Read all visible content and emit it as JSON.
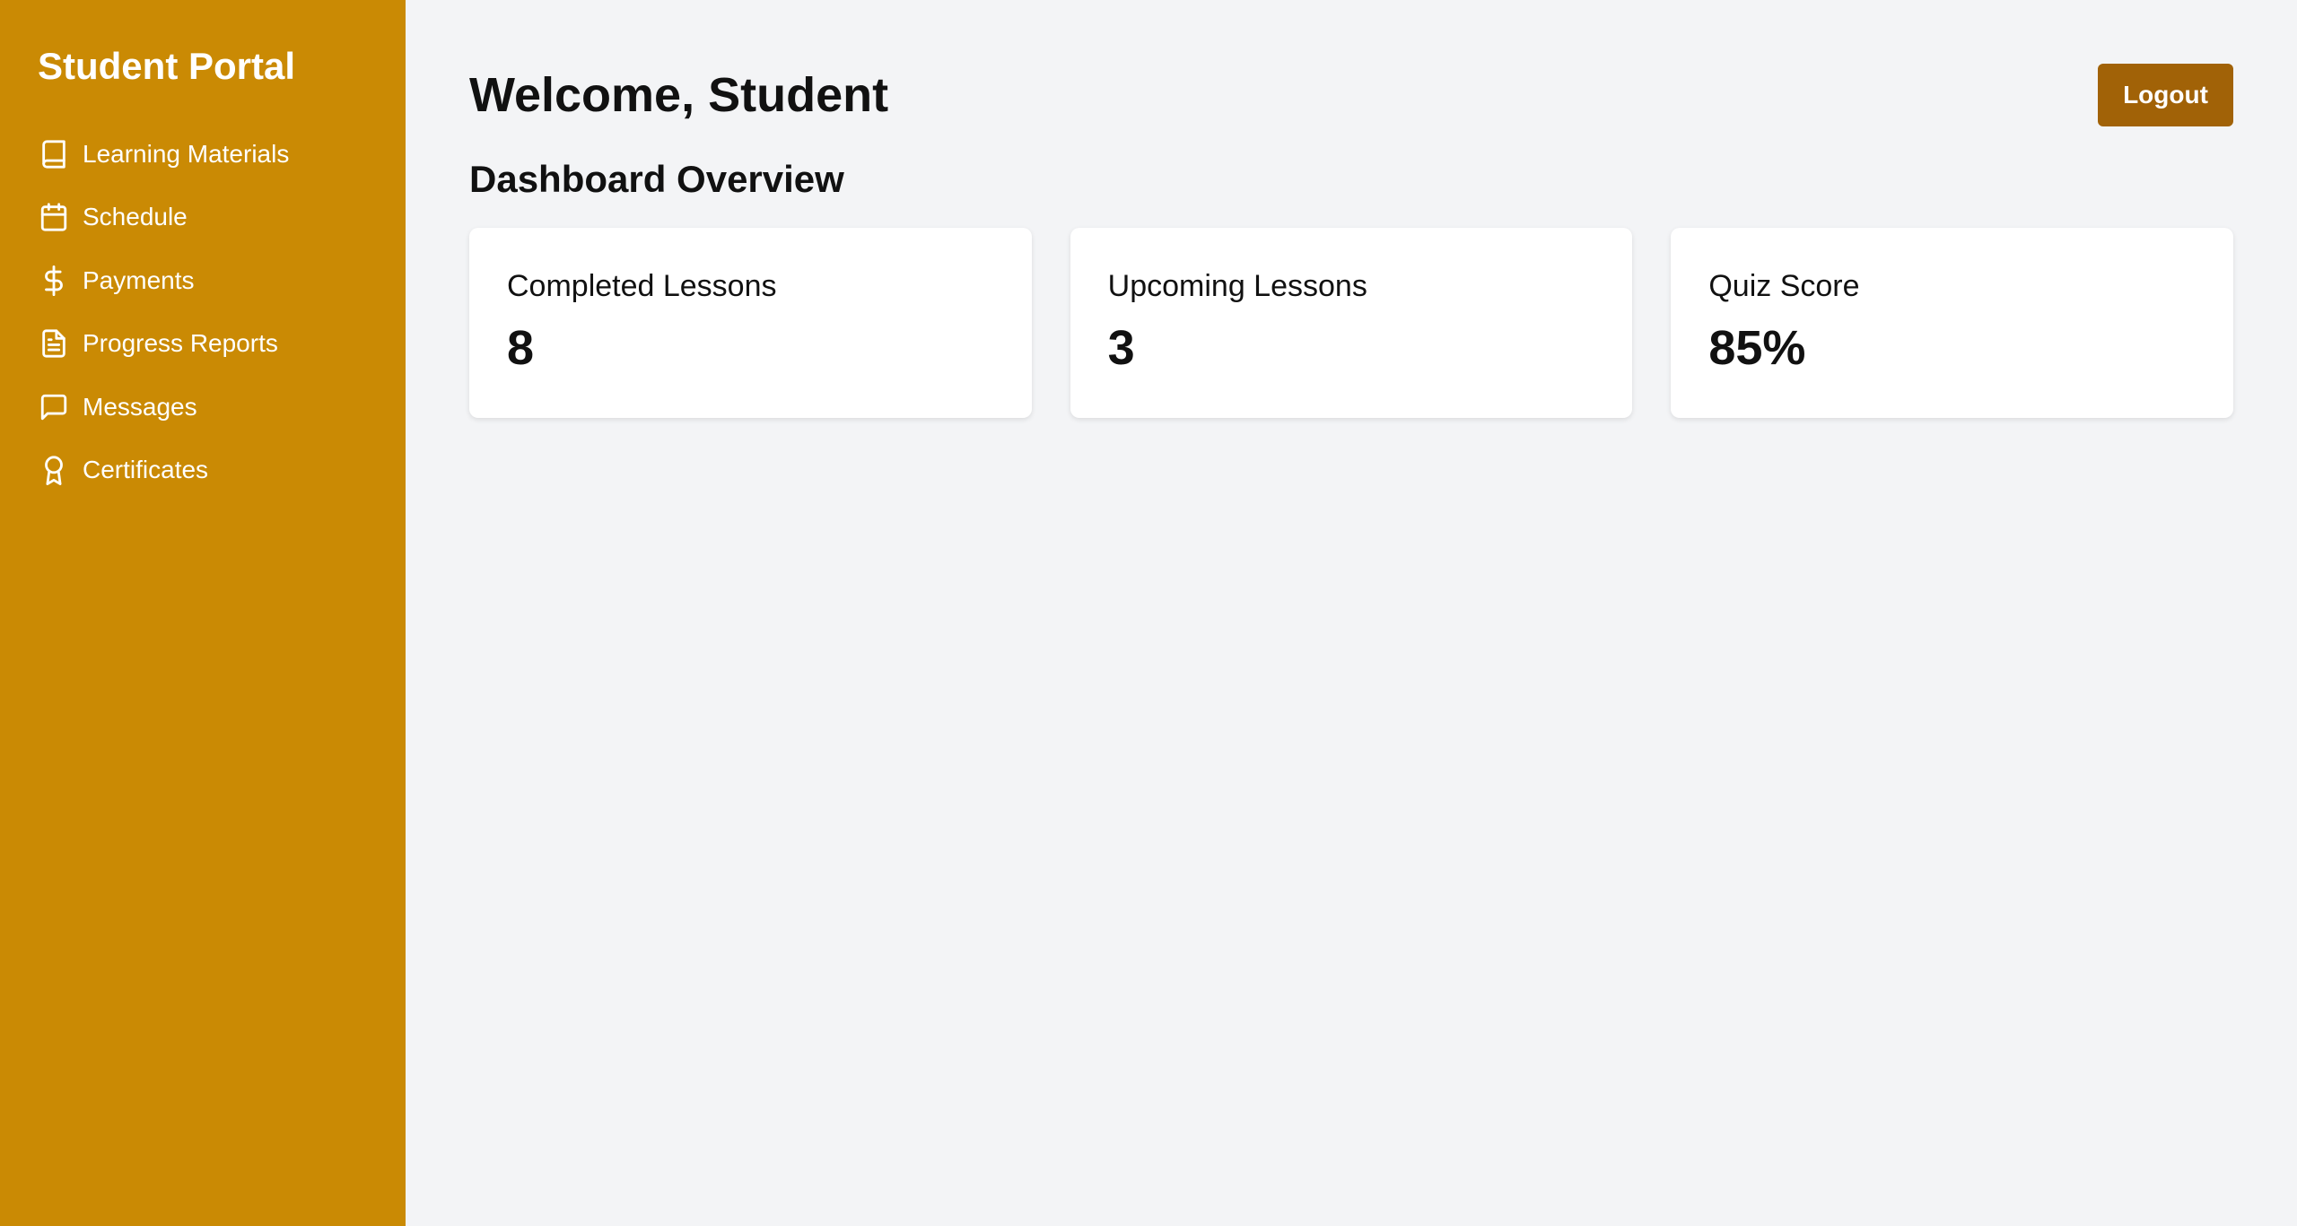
{
  "app": {
    "title": "Student Portal"
  },
  "sidebar": {
    "items": [
      {
        "label": "Learning Materials",
        "icon": "book-icon"
      },
      {
        "label": "Schedule",
        "icon": "calendar-icon"
      },
      {
        "label": "Payments",
        "icon": "dollar-icon"
      },
      {
        "label": "Progress Reports",
        "icon": "document-icon"
      },
      {
        "label": "Messages",
        "icon": "message-icon"
      },
      {
        "label": "Certificates",
        "icon": "award-icon"
      }
    ]
  },
  "header": {
    "welcome": "Welcome, Student",
    "logout_label": "Logout"
  },
  "dashboard": {
    "title": "Dashboard Overview",
    "cards": [
      {
        "label": "Completed Lessons",
        "value": "8"
      },
      {
        "label": "Upcoming Lessons",
        "value": "3"
      },
      {
        "label": "Quiz Score",
        "value": "85%"
      }
    ]
  },
  "colors": {
    "sidebar": "#ca8a04",
    "button": "#a16207",
    "background": "#f3f4f6"
  }
}
